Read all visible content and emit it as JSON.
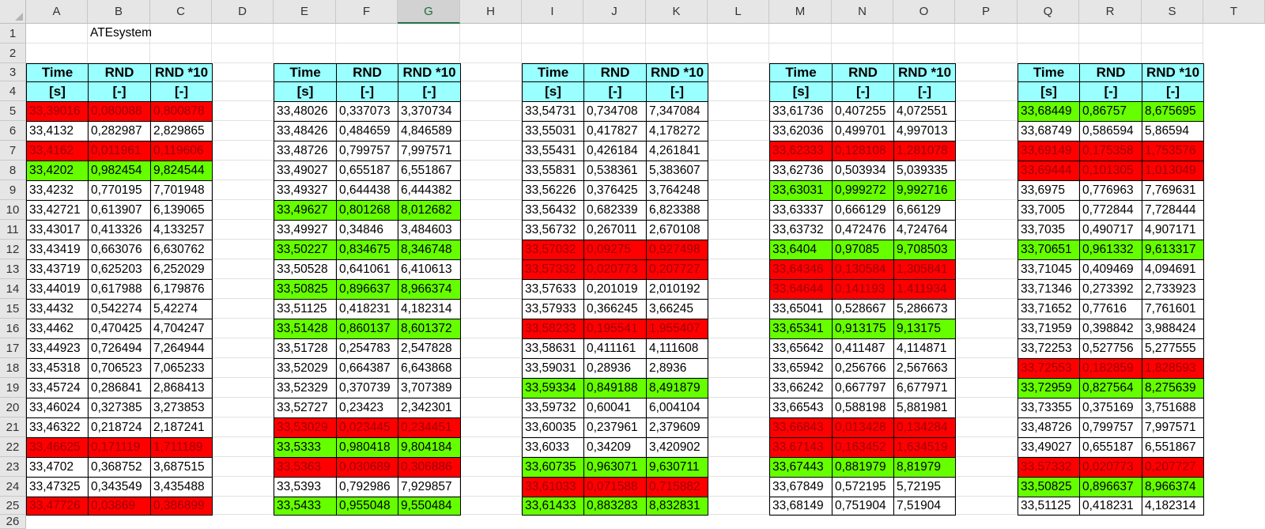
{
  "sheet": {
    "title_cell": "ATEsystem",
    "columns": [
      "A",
      "B",
      "C",
      "D",
      "E",
      "F",
      "G",
      "H",
      "I",
      "J",
      "K",
      "L",
      "M",
      "N",
      "O",
      "P",
      "Q",
      "R",
      "S",
      "T"
    ],
    "selected_column": "G",
    "rows": [
      "1",
      "2",
      "3",
      "4",
      "5",
      "6",
      "7",
      "8",
      "9",
      "10",
      "11",
      "12",
      "13",
      "14",
      "15",
      "16",
      "17",
      "18",
      "19",
      "20",
      "21",
      "22",
      "23",
      "24",
      "25",
      "26"
    ],
    "colors": {
      "red": "#ff0000",
      "green": "#66ff00",
      "header": "#99ffff",
      "red_text": "#9c0006"
    },
    "header_labels": [
      "Time",
      "RND",
      "RND *10"
    ],
    "unit_labels": [
      "[s]",
      "[-]",
      "[-]"
    ]
  },
  "tables": [
    {
      "rows": [
        {
          "v": [
            "33,39016",
            "0,080088",
            "0,800878"
          ],
          "hl": "red"
        },
        {
          "v": [
            "33,4132",
            "0,282987",
            "2,829865"
          ],
          "hl": ""
        },
        {
          "v": [
            "33,4162",
            "0,011961",
            "0,119606"
          ],
          "hl": "red"
        },
        {
          "v": [
            "33,4202",
            "0,982454",
            "9,824544"
          ],
          "hl": "green"
        },
        {
          "v": [
            "33,4232",
            "0,770195",
            "7,701948"
          ],
          "hl": ""
        },
        {
          "v": [
            "33,42721",
            "0,613907",
            "6,139065"
          ],
          "hl": ""
        },
        {
          "v": [
            "33,43017",
            "0,413326",
            "4,133257"
          ],
          "hl": ""
        },
        {
          "v": [
            "33,43419",
            "0,663076",
            "6,630762"
          ],
          "hl": ""
        },
        {
          "v": [
            "33,43719",
            "0,625203",
            "6,252029"
          ],
          "hl": ""
        },
        {
          "v": [
            "33,44019",
            "0,617988",
            "6,179876"
          ],
          "hl": ""
        },
        {
          "v": [
            "33,4432",
            "0,542274",
            "5,42274"
          ],
          "hl": ""
        },
        {
          "v": [
            "33,4462",
            "0,470425",
            "4,704247"
          ],
          "hl": ""
        },
        {
          "v": [
            "33,44923",
            "0,726494",
            "7,264944"
          ],
          "hl": ""
        },
        {
          "v": [
            "33,45318",
            "0,706523",
            "7,065233"
          ],
          "hl": ""
        },
        {
          "v": [
            "33,45724",
            "0,286841",
            "2,868413"
          ],
          "hl": ""
        },
        {
          "v": [
            "33,46024",
            "0,327385",
            "3,273853"
          ],
          "hl": ""
        },
        {
          "v": [
            "33,46322",
            "0,218724",
            "2,187241"
          ],
          "hl": ""
        },
        {
          "v": [
            "33,46625",
            "0,171119",
            "1,711189"
          ],
          "hl": "red"
        },
        {
          "v": [
            "33,4702",
            "0,368752",
            "3,687515"
          ],
          "hl": ""
        },
        {
          "v": [
            "33,47325",
            "0,343549",
            "3,435488"
          ],
          "hl": ""
        },
        {
          "v": [
            "33,47726",
            "0,03869",
            "0,386899"
          ],
          "hl": "red"
        }
      ]
    },
    {
      "rows": [
        {
          "v": [
            "33,48026",
            "0,337073",
            "3,370734"
          ],
          "hl": ""
        },
        {
          "v": [
            "33,48426",
            "0,484659",
            "4,846589"
          ],
          "hl": ""
        },
        {
          "v": [
            "33,48726",
            "0,799757",
            "7,997571"
          ],
          "hl": ""
        },
        {
          "v": [
            "33,49027",
            "0,655187",
            "6,551867"
          ],
          "hl": ""
        },
        {
          "v": [
            "33,49327",
            "0,644438",
            "6,444382"
          ],
          "hl": ""
        },
        {
          "v": [
            "33,49627",
            "0,801268",
            "8,012682"
          ],
          "hl": "green"
        },
        {
          "v": [
            "33,49927",
            "0,34846",
            "3,484603"
          ],
          "hl": ""
        },
        {
          "v": [
            "33,50227",
            "0,834675",
            "8,346748"
          ],
          "hl": "green"
        },
        {
          "v": [
            "33,50528",
            "0,641061",
            "6,410613"
          ],
          "hl": ""
        },
        {
          "v": [
            "33,50825",
            "0,896637",
            "8,966374"
          ],
          "hl": "green"
        },
        {
          "v": [
            "33,51125",
            "0,418231",
            "4,182314"
          ],
          "hl": ""
        },
        {
          "v": [
            "33,51428",
            "0,860137",
            "8,601372"
          ],
          "hl": "green"
        },
        {
          "v": [
            "33,51728",
            "0,254783",
            "2,547828"
          ],
          "hl": ""
        },
        {
          "v": [
            "33,52029",
            "0,664387",
            "6,643868"
          ],
          "hl": ""
        },
        {
          "v": [
            "33,52329",
            "0,370739",
            "3,707389"
          ],
          "hl": ""
        },
        {
          "v": [
            "33,52727",
            "0,23423",
            "2,342301"
          ],
          "hl": ""
        },
        {
          "v": [
            "33,53029",
            "0,023445",
            "0,234451"
          ],
          "hl": "red"
        },
        {
          "v": [
            "33,5333",
            "0,980418",
            "9,804184"
          ],
          "hl": "green"
        },
        {
          "v": [
            "33,5363",
            "0,030689",
            "0,306886"
          ],
          "hl": "red"
        },
        {
          "v": [
            "33,5393",
            "0,792986",
            "7,929857"
          ],
          "hl": ""
        },
        {
          "v": [
            "33,5433",
            "0,955048",
            "9,550484"
          ],
          "hl": "green"
        }
      ]
    },
    {
      "rows": [
        {
          "v": [
            "33,54731",
            "0,734708",
            "7,347084"
          ],
          "hl": ""
        },
        {
          "v": [
            "33,55031",
            "0,417827",
            "4,178272"
          ],
          "hl": ""
        },
        {
          "v": [
            "33,55431",
            "0,426184",
            "4,261841"
          ],
          "hl": ""
        },
        {
          "v": [
            "33,55831",
            "0,538361",
            "5,383607"
          ],
          "hl": ""
        },
        {
          "v": [
            "33,56226",
            "0,376425",
            "3,764248"
          ],
          "hl": ""
        },
        {
          "v": [
            "33,56432",
            "0,682339",
            "6,823388"
          ],
          "hl": ""
        },
        {
          "v": [
            "33,56732",
            "0,267011",
            "2,670108"
          ],
          "hl": ""
        },
        {
          "v": [
            "33,57032",
            "0,09275",
            "0,927498"
          ],
          "hl": "red"
        },
        {
          "v": [
            "33,57332",
            "0,020773",
            "0,207727"
          ],
          "hl": "red"
        },
        {
          "v": [
            "33,57633",
            "0,201019",
            "2,010192"
          ],
          "hl": ""
        },
        {
          "v": [
            "33,57933",
            "0,366245",
            "3,66245"
          ],
          "hl": ""
        },
        {
          "v": [
            "33,58233",
            "0,195541",
            "1,955407"
          ],
          "hl": "red"
        },
        {
          "v": [
            "33,58631",
            "0,411161",
            "4,111608"
          ],
          "hl": ""
        },
        {
          "v": [
            "33,59031",
            "0,28936",
            "2,8936"
          ],
          "hl": ""
        },
        {
          "v": [
            "33,59334",
            "0,849188",
            "8,491879"
          ],
          "hl": "green"
        },
        {
          "v": [
            "33,59732",
            "0,60041",
            "6,004104"
          ],
          "hl": ""
        },
        {
          "v": [
            "33,60035",
            "0,237961",
            "2,379609"
          ],
          "hl": ""
        },
        {
          "v": [
            "33,6033",
            "0,34209",
            "3,420902"
          ],
          "hl": ""
        },
        {
          "v": [
            "33,60735",
            "0,963071",
            "9,630711"
          ],
          "hl": "green"
        },
        {
          "v": [
            "33,61033",
            "0,071588",
            "0,715882"
          ],
          "hl": "red"
        },
        {
          "v": [
            "33,61433",
            "0,883283",
            "8,832831"
          ],
          "hl": "green"
        }
      ]
    },
    {
      "rows": [
        {
          "v": [
            "33,61736",
            "0,407255",
            "4,072551"
          ],
          "hl": ""
        },
        {
          "v": [
            "33,62036",
            "0,499701",
            "4,997013"
          ],
          "hl": ""
        },
        {
          "v": [
            "33,62333",
            "0,128108",
            "1,281078"
          ],
          "hl": "red"
        },
        {
          "v": [
            "33,62736",
            "0,503934",
            "5,039335"
          ],
          "hl": ""
        },
        {
          "v": [
            "33,63031",
            "0,999272",
            "9,992716"
          ],
          "hl": "green"
        },
        {
          "v": [
            "33,63337",
            "0,666129",
            "6,66129"
          ],
          "hl": ""
        },
        {
          "v": [
            "33,63732",
            "0,472476",
            "4,724764"
          ],
          "hl": ""
        },
        {
          "v": [
            "33,6404",
            "0,97085",
            "9,708503"
          ],
          "hl": "green"
        },
        {
          "v": [
            "33,64346",
            "0,130584",
            "1,305841"
          ],
          "hl": "red"
        },
        {
          "v": [
            "33,64644",
            "0,141193",
            "1,411934"
          ],
          "hl": "red"
        },
        {
          "v": [
            "33,65041",
            "0,528667",
            "5,286673"
          ],
          "hl": ""
        },
        {
          "v": [
            "33,65341",
            "0,913175",
            "9,13175"
          ],
          "hl": "green"
        },
        {
          "v": [
            "33,65642",
            "0,411487",
            "4,114871"
          ],
          "hl": ""
        },
        {
          "v": [
            "33,65942",
            "0,256766",
            "2,567663"
          ],
          "hl": ""
        },
        {
          "v": [
            "33,66242",
            "0,667797",
            "6,677971"
          ],
          "hl": ""
        },
        {
          "v": [
            "33,66543",
            "0,588198",
            "5,881981"
          ],
          "hl": ""
        },
        {
          "v": [
            "33,66843",
            "0,013428",
            "0,134284"
          ],
          "hl": "red"
        },
        {
          "v": [
            "33,67143",
            "0,163452",
            "1,634519"
          ],
          "hl": "red"
        },
        {
          "v": [
            "33,67443",
            "0,881979",
            "8,81979"
          ],
          "hl": "green"
        },
        {
          "v": [
            "33,67849",
            "0,572195",
            "5,72195"
          ],
          "hl": ""
        },
        {
          "v": [
            "33,68149",
            "0,751904",
            "7,51904"
          ],
          "hl": ""
        }
      ]
    },
    {
      "rows": [
        {
          "v": [
            "33,68449",
            "0,86757",
            "8,675695"
          ],
          "hl": "green"
        },
        {
          "v": [
            "33,68749",
            "0,586594",
            "5,86594"
          ],
          "hl": ""
        },
        {
          "v": [
            "33,69149",
            "0,175358",
            "1,753576"
          ],
          "hl": "red"
        },
        {
          "v": [
            "33,69444",
            "0,101305",
            "1,013049"
          ],
          "hl": "red"
        },
        {
          "v": [
            "33,6975",
            "0,776963",
            "7,769631"
          ],
          "hl": ""
        },
        {
          "v": [
            "33,7005",
            "0,772844",
            "7,728444"
          ],
          "hl": ""
        },
        {
          "v": [
            "33,7035",
            "0,490717",
            "4,907171"
          ],
          "hl": ""
        },
        {
          "v": [
            "33,70651",
            "0,961332",
            "9,613317"
          ],
          "hl": "green"
        },
        {
          "v": [
            "33,71045",
            "0,409469",
            "4,094691"
          ],
          "hl": ""
        },
        {
          "v": [
            "33,71346",
            "0,273392",
            "2,733923"
          ],
          "hl": ""
        },
        {
          "v": [
            "33,71652",
            "0,77616",
            "7,761601"
          ],
          "hl": ""
        },
        {
          "v": [
            "33,71959",
            "0,398842",
            "3,988424"
          ],
          "hl": ""
        },
        {
          "v": [
            "33,72253",
            "0,527756",
            "5,277555"
          ],
          "hl": ""
        },
        {
          "v": [
            "33,72553",
            "0,182859",
            "1,828593"
          ],
          "hl": "red"
        },
        {
          "v": [
            "33,72959",
            "0,827564",
            "8,275639"
          ],
          "hl": "green"
        },
        {
          "v": [
            "33,73355",
            "0,375169",
            "3,751688"
          ],
          "hl": ""
        },
        {
          "v": [
            "33,48726",
            "0,799757",
            "7,997571"
          ],
          "hl": ""
        },
        {
          "v": [
            "33,49027",
            "0,655187",
            "6,551867"
          ],
          "hl": ""
        },
        {
          "v": [
            "33,57332",
            "0,020773",
            "0,207727"
          ],
          "hl": "red"
        },
        {
          "v": [
            "33,50825",
            "0,896637",
            "8,966374"
          ],
          "hl": "green"
        },
        {
          "v": [
            "33,51125",
            "0,418231",
            "4,182314"
          ],
          "hl": ""
        }
      ]
    }
  ]
}
